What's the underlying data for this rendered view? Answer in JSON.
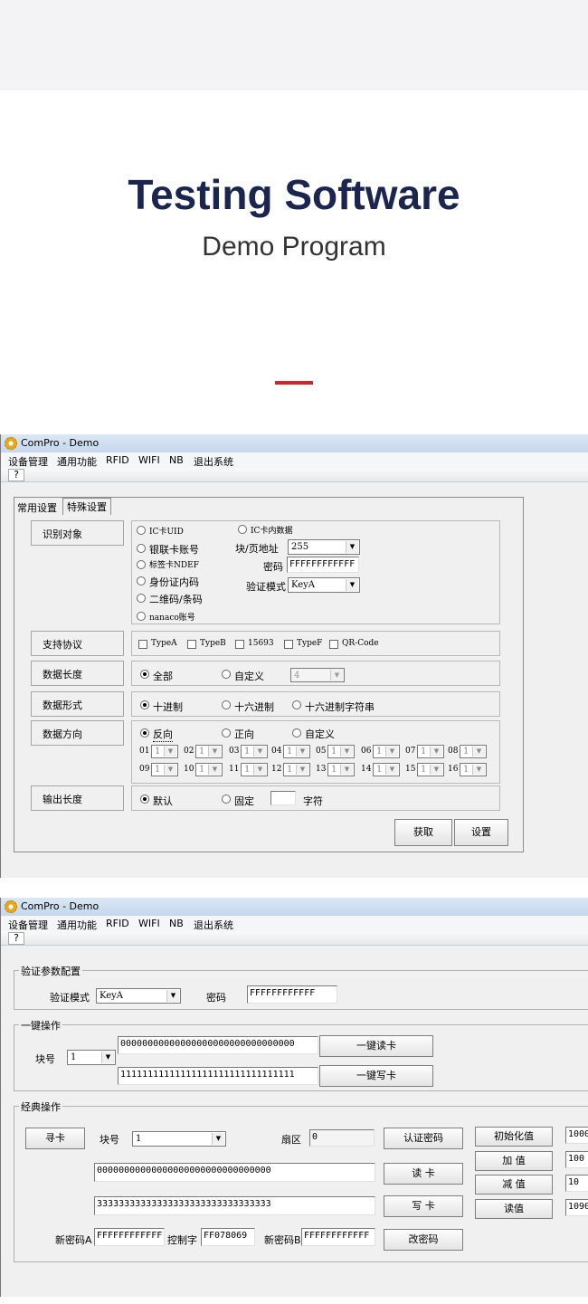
{
  "hero": {
    "title": "Testing Software",
    "subtitle": "Demo Program"
  },
  "app": {
    "title": "ComPro - Demo",
    "menu": [
      "设备管理",
      "通用功能",
      "RFID",
      "WIFI",
      "NB",
      "退出系统"
    ],
    "help_glyph": "?"
  },
  "win1": {
    "tabs": [
      "常用设置",
      "特殊设置"
    ],
    "rows": {
      "ident": "识别对象",
      "protocol": "支持协议",
      "length": "数据长度",
      "format": "数据形式",
      "direction": "数据方向",
      "output": "输出长度"
    },
    "ident_options": [
      "IC卡UID",
      "银联卡账号",
      "标签卡NDEF",
      "身份证内码",
      "二维码/条码",
      "nanaco账号"
    ],
    "ic_data": "IC卡内数据",
    "block_page_label": "块/页地址",
    "block_page_value": "255",
    "password_label": "密码",
    "password_value": "FFFFFFFFFFFF",
    "auth_mode_label": "验证模式",
    "auth_mode_value": "KeyA",
    "protocols": [
      "TypeA",
      "TypeB",
      "15693",
      "TypeF",
      "QR-Code"
    ],
    "length_all": "全部",
    "length_custom": "自定义",
    "length_value": "4",
    "format_options": [
      "十进制",
      "十六进制",
      "十六进制字符串"
    ],
    "direction_options": [
      "反向",
      "正向",
      "自定义"
    ],
    "byte_labels": [
      "01",
      "02",
      "03",
      "04",
      "05",
      "06",
      "07",
      "08",
      "09",
      "10",
      "11",
      "12",
      "13",
      "14",
      "15",
      "16"
    ],
    "byte_value": "1",
    "output_default": "默认",
    "output_fixed": "固定",
    "output_unit": "字符",
    "get_button": "获取",
    "set_button": "设置"
  },
  "win2": {
    "auth_legend": "验证参数配置",
    "auth_mode_label": "验证模式",
    "auth_mode_value": "KeyA",
    "password_label": "密码",
    "password_value": "FFFFFFFFFFFF",
    "onekey_legend": "一键操作",
    "block_label": "块号",
    "block_value": "1",
    "read_data": "00000000000000000000000000000000",
    "write_data": "11111111111111111111111111111111",
    "onekey_read": "一键读卡",
    "onekey_write": "一键写卡",
    "classic_legend": "经典操作",
    "search_card": "寻卡",
    "classic_block_label": "块号",
    "classic_block_value": "1",
    "sector_label": "扇区",
    "sector_value": "0",
    "auth_password_button": "认证密码",
    "classic_read_data": "00000000000000000000000000000000",
    "classic_write_data": "33333333333333333333333333333333",
    "read_card": "读 卡",
    "write_card": "写 卡",
    "new_key_a_label": "新密码A",
    "new_key_a_value": "FFFFFFFFFFFF",
    "control_label": "控制字",
    "control_value": "FF078069",
    "new_key_b_label": "新密码B",
    "new_key_b_value": "FFFFFFFFFFFF",
    "change_password": "改密码",
    "init_value": "初始化值",
    "add_value": "加 值",
    "sub_value": "减 值",
    "read_value": "读值",
    "val_init": "1000",
    "val_add": "100",
    "val_sub": "10",
    "val_read": "1090"
  }
}
